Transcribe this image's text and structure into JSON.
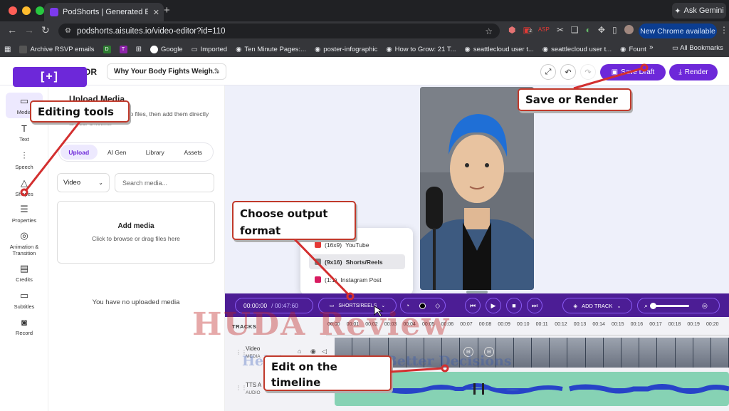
{
  "browser": {
    "tab_title": "PodShorts | Generated Episo",
    "new_tab": "+",
    "ask_gemini": "Ask Gemini",
    "url": "podshorts.aisuites.io/video-editor?id=110",
    "new_chrome": "New Chrome available",
    "ext_badge": "2",
    "bookmarks": [
      {
        "label": "Archive RSVP emails",
        "icon": "puzzle-icon",
        "color": "#555555"
      },
      {
        "label": "D",
        "icon": "badge-icon",
        "color": "#2e7d32"
      },
      {
        "label": "T",
        "icon": "badge-icon",
        "color": "#8e24aa"
      },
      {
        "label": "Google",
        "icon": "google-icon",
        "color": "#4285f4"
      },
      {
        "label": "Imported",
        "icon": "folder-icon",
        "color": "#c8c8c8"
      },
      {
        "label": "Ten Minute Pages:...",
        "icon": "globe-icon",
        "color": "#c8c8c8"
      },
      {
        "label": "poster-infographic",
        "icon": "globe-icon",
        "color": "#c8c8c8"
      },
      {
        "label": "How to Grow: 21 T...",
        "icon": "globe-icon",
        "color": "#c8c8c8"
      },
      {
        "label": "seattlecloud user t...",
        "icon": "globe-icon",
        "color": "#c8c8c8"
      },
      {
        "label": "seattlecloud user t...",
        "icon": "globe-icon",
        "color": "#c8c8c8"
      },
      {
        "label": "Fount",
        "icon": "globe-icon",
        "color": "#c8c8c8"
      }
    ],
    "all_bookmarks": "All Bookmarks"
  },
  "app": {
    "brand": "OR",
    "logo": "[+]",
    "project_title": "Why Your Body Fights Weigh...",
    "save_label": "Save Draft",
    "render_label": "Render",
    "accent": "#6d28d9"
  },
  "sidebar": [
    {
      "label": "Media",
      "icon": "folder-icon"
    },
    {
      "label": "Text",
      "icon": "text-icon"
    },
    {
      "label": "Speech",
      "icon": "waveform-icon"
    },
    {
      "label": "Shapes",
      "icon": "shapes-icon"
    },
    {
      "label": "Properties",
      "icon": "sliders-icon"
    },
    {
      "label": "Animation & Transition",
      "icon": "animation-icon"
    },
    {
      "label": "Credits",
      "icon": "clapper-icon"
    },
    {
      "label": "Subtitles",
      "icon": "subtitles-icon"
    },
    {
      "label": "Record",
      "icon": "camera-icon"
    }
  ],
  "panel": {
    "heading": "Upload Media",
    "description": "video, image, and audio files, then add them directly to your timeline.",
    "tabs": [
      "Upload",
      "AI Gen",
      "Library",
      "Assets"
    ],
    "type_value": "Video",
    "search_placeholder": "Search media...",
    "add_media_title": "Add media",
    "add_media_hint": "Click to browse or drag files here",
    "empty_text": "You have no uploaded media"
  },
  "player": {
    "current_time": "00:00:00",
    "duration": "/ 00:47:60",
    "format_label": "SHORTS/REELS",
    "add_track": "ADD TRACK"
  },
  "format_menu": [
    {
      "ratio": "(16x9)",
      "name": "YouTube",
      "color": "#e53935",
      "selected": false
    },
    {
      "ratio": "(9x16)",
      "name": "Shorts/Reels",
      "color": "#7c7c7c",
      "selected": true
    },
    {
      "ratio": "(1:1)",
      "name": "Instagram Post",
      "color": "#d81b60",
      "selected": false
    }
  ],
  "timeline": {
    "tracks_label": "TRACKS",
    "ticks": [
      "00:00",
      "00:01",
      "00:02",
      "00:03",
      "00:04",
      "00:05",
      "00:06",
      "00:07",
      "00:08",
      "00:09",
      "00:10",
      "00:11",
      "00:12",
      "00:13",
      "00:14",
      "00:15",
      "00:16",
      "00:17",
      "00:18",
      "00:19",
      "00:20"
    ],
    "video_track": {
      "label": "Video",
      "sub": "MEDIA"
    },
    "audio_track": {
      "label": "TTS A",
      "sub": "AUDIO"
    }
  },
  "annotations": {
    "editing_tools": "Editing tools",
    "save_render": "Save or Render",
    "choose_format": "Choose output format",
    "edit_timeline": "Edit on the timeline"
  },
  "watermark": {
    "main": "HUDA Review",
    "sub": "Helping You Make Better Decisions"
  }
}
